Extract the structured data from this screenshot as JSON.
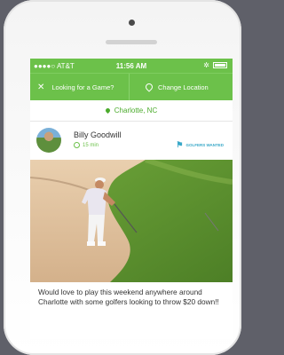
{
  "status_bar": {
    "carrier": "●●●●○ AT&T",
    "time": "11:56 AM",
    "bluetooth": "✲"
  },
  "nav": {
    "left_label": "Looking for a Game?",
    "right_label": "Change Location",
    "left_icon": "crossed-clubs-icon",
    "right_icon": "location-pin-icon"
  },
  "location": {
    "label": "Charlotte, NC"
  },
  "post": {
    "username": "Billy Goodwill",
    "time_ago": "15 min",
    "badge": "GOLFERS WANTED",
    "body": "Would love to play this weekend anywhere around Charlotte with some golfers looking to throw $20 down!!"
  },
  "colors": {
    "accent": "#6cc14a",
    "badge": "#39a8c8",
    "background": "#5f6069"
  }
}
